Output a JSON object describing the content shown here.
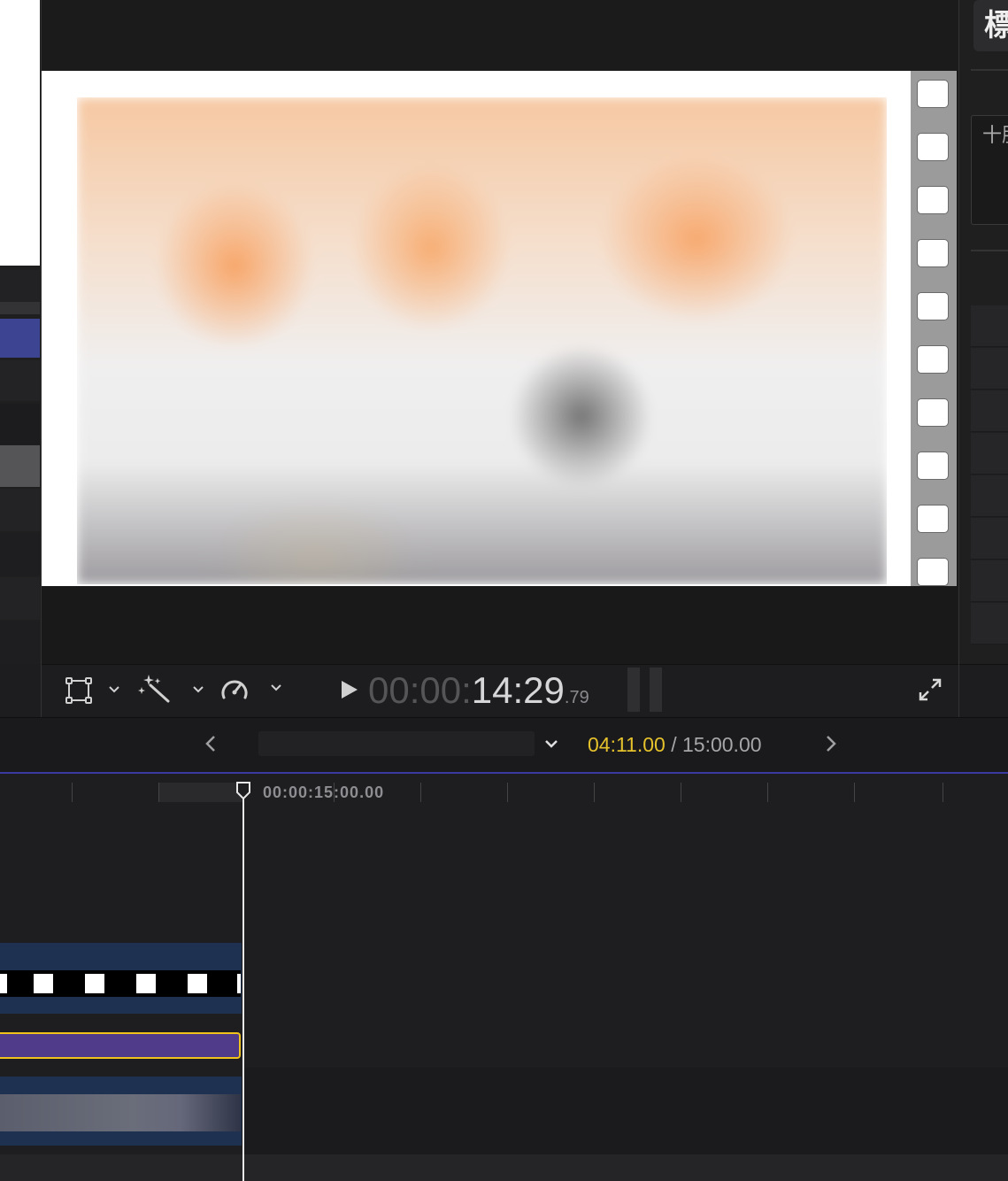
{
  "viewer": {
    "timecode_dim": "00:00:",
    "timecode_main": "14:29",
    "timecode_frames": ".79"
  },
  "toolbar": {
    "transform_icon": "transform-crop-icon",
    "enhance_icon": "magic-wand-icon",
    "retime_icon": "speedometer-icon",
    "fullscreen_icon": "fullscreen-expand-icon"
  },
  "timeline": {
    "position_current": "04:11.00",
    "position_separator": " / ",
    "position_total": "15:00.00",
    "ruler_label": "00:00:15:00.00"
  },
  "inspector": {
    "title_glyph": "標",
    "box_text": "十肝"
  },
  "colors": {
    "accent_yellow": "#e5c22c",
    "title_clip": "#503a8a",
    "clip_band": "#1f3151",
    "selection_outline": "#f0c21c",
    "sidebar_selected": "#3d4592"
  }
}
